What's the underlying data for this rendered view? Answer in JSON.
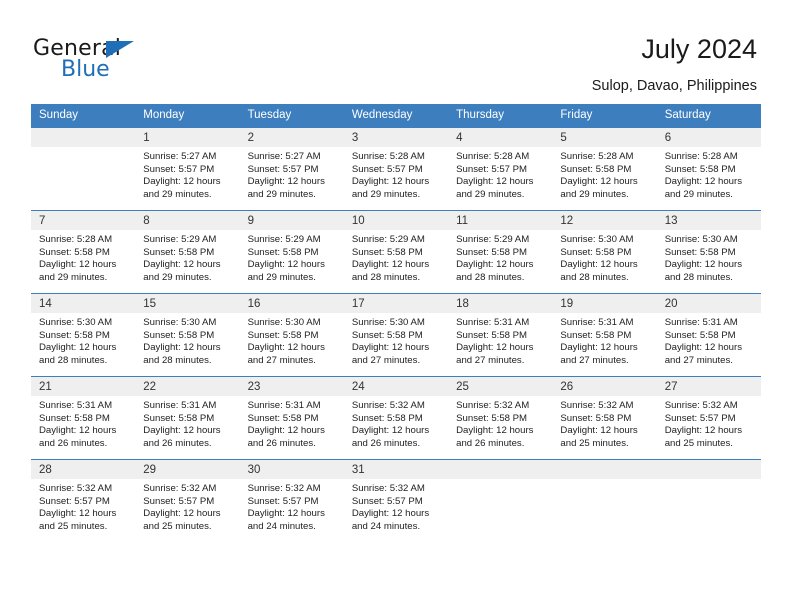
{
  "brand": {
    "name_part1": "General",
    "name_part2": "Blue",
    "triangle_color": "#1f6fb8"
  },
  "header": {
    "title": "July 2024",
    "subtitle": "Sulop, Davao, Philippines"
  },
  "theme": {
    "header_blue": "#3d7ebf",
    "band_gray": "#efefef",
    "text": "#222222"
  },
  "calendar": {
    "weekday_headers": [
      "Sunday",
      "Monday",
      "Tuesday",
      "Wednesday",
      "Thursday",
      "Friday",
      "Saturday"
    ],
    "weeks": [
      [
        {
          "day": "",
          "lines": []
        },
        {
          "day": "1",
          "lines": [
            "Sunrise: 5:27 AM",
            "Sunset: 5:57 PM",
            "Daylight: 12 hours",
            "and 29 minutes."
          ]
        },
        {
          "day": "2",
          "lines": [
            "Sunrise: 5:27 AM",
            "Sunset: 5:57 PM",
            "Daylight: 12 hours",
            "and 29 minutes."
          ]
        },
        {
          "day": "3",
          "lines": [
            "Sunrise: 5:28 AM",
            "Sunset: 5:57 PM",
            "Daylight: 12 hours",
            "and 29 minutes."
          ]
        },
        {
          "day": "4",
          "lines": [
            "Sunrise: 5:28 AM",
            "Sunset: 5:57 PM",
            "Daylight: 12 hours",
            "and 29 minutes."
          ]
        },
        {
          "day": "5",
          "lines": [
            "Sunrise: 5:28 AM",
            "Sunset: 5:58 PM",
            "Daylight: 12 hours",
            "and 29 minutes."
          ]
        },
        {
          "day": "6",
          "lines": [
            "Sunrise: 5:28 AM",
            "Sunset: 5:58 PM",
            "Daylight: 12 hours",
            "and 29 minutes."
          ]
        }
      ],
      [
        {
          "day": "7",
          "lines": [
            "Sunrise: 5:28 AM",
            "Sunset: 5:58 PM",
            "Daylight: 12 hours",
            "and 29 minutes."
          ]
        },
        {
          "day": "8",
          "lines": [
            "Sunrise: 5:29 AM",
            "Sunset: 5:58 PM",
            "Daylight: 12 hours",
            "and 29 minutes."
          ]
        },
        {
          "day": "9",
          "lines": [
            "Sunrise: 5:29 AM",
            "Sunset: 5:58 PM",
            "Daylight: 12 hours",
            "and 29 minutes."
          ]
        },
        {
          "day": "10",
          "lines": [
            "Sunrise: 5:29 AM",
            "Sunset: 5:58 PM",
            "Daylight: 12 hours",
            "and 28 minutes."
          ]
        },
        {
          "day": "11",
          "lines": [
            "Sunrise: 5:29 AM",
            "Sunset: 5:58 PM",
            "Daylight: 12 hours",
            "and 28 minutes."
          ]
        },
        {
          "day": "12",
          "lines": [
            "Sunrise: 5:30 AM",
            "Sunset: 5:58 PM",
            "Daylight: 12 hours",
            "and 28 minutes."
          ]
        },
        {
          "day": "13",
          "lines": [
            "Sunrise: 5:30 AM",
            "Sunset: 5:58 PM",
            "Daylight: 12 hours",
            "and 28 minutes."
          ]
        }
      ],
      [
        {
          "day": "14",
          "lines": [
            "Sunrise: 5:30 AM",
            "Sunset: 5:58 PM",
            "Daylight: 12 hours",
            "and 28 minutes."
          ]
        },
        {
          "day": "15",
          "lines": [
            "Sunrise: 5:30 AM",
            "Sunset: 5:58 PM",
            "Daylight: 12 hours",
            "and 28 minutes."
          ]
        },
        {
          "day": "16",
          "lines": [
            "Sunrise: 5:30 AM",
            "Sunset: 5:58 PM",
            "Daylight: 12 hours",
            "and 27 minutes."
          ]
        },
        {
          "day": "17",
          "lines": [
            "Sunrise: 5:30 AM",
            "Sunset: 5:58 PM",
            "Daylight: 12 hours",
            "and 27 minutes."
          ]
        },
        {
          "day": "18",
          "lines": [
            "Sunrise: 5:31 AM",
            "Sunset: 5:58 PM",
            "Daylight: 12 hours",
            "and 27 minutes."
          ]
        },
        {
          "day": "19",
          "lines": [
            "Sunrise: 5:31 AM",
            "Sunset: 5:58 PM",
            "Daylight: 12 hours",
            "and 27 minutes."
          ]
        },
        {
          "day": "20",
          "lines": [
            "Sunrise: 5:31 AM",
            "Sunset: 5:58 PM",
            "Daylight: 12 hours",
            "and 27 minutes."
          ]
        }
      ],
      [
        {
          "day": "21",
          "lines": [
            "Sunrise: 5:31 AM",
            "Sunset: 5:58 PM",
            "Daylight: 12 hours",
            "and 26 minutes."
          ]
        },
        {
          "day": "22",
          "lines": [
            "Sunrise: 5:31 AM",
            "Sunset: 5:58 PM",
            "Daylight: 12 hours",
            "and 26 minutes."
          ]
        },
        {
          "day": "23",
          "lines": [
            "Sunrise: 5:31 AM",
            "Sunset: 5:58 PM",
            "Daylight: 12 hours",
            "and 26 minutes."
          ]
        },
        {
          "day": "24",
          "lines": [
            "Sunrise: 5:32 AM",
            "Sunset: 5:58 PM",
            "Daylight: 12 hours",
            "and 26 minutes."
          ]
        },
        {
          "day": "25",
          "lines": [
            "Sunrise: 5:32 AM",
            "Sunset: 5:58 PM",
            "Daylight: 12 hours",
            "and 26 minutes."
          ]
        },
        {
          "day": "26",
          "lines": [
            "Sunrise: 5:32 AM",
            "Sunset: 5:58 PM",
            "Daylight: 12 hours",
            "and 25 minutes."
          ]
        },
        {
          "day": "27",
          "lines": [
            "Sunrise: 5:32 AM",
            "Sunset: 5:57 PM",
            "Daylight: 12 hours",
            "and 25 minutes."
          ]
        }
      ],
      [
        {
          "day": "28",
          "lines": [
            "Sunrise: 5:32 AM",
            "Sunset: 5:57 PM",
            "Daylight: 12 hours",
            "and 25 minutes."
          ]
        },
        {
          "day": "29",
          "lines": [
            "Sunrise: 5:32 AM",
            "Sunset: 5:57 PM",
            "Daylight: 12 hours",
            "and 25 minutes."
          ]
        },
        {
          "day": "30",
          "lines": [
            "Sunrise: 5:32 AM",
            "Sunset: 5:57 PM",
            "Daylight: 12 hours",
            "and 24 minutes."
          ]
        },
        {
          "day": "31",
          "lines": [
            "Sunrise: 5:32 AM",
            "Sunset: 5:57 PM",
            "Daylight: 12 hours",
            "and 24 minutes."
          ]
        },
        {
          "day": "",
          "lines": []
        },
        {
          "day": "",
          "lines": []
        },
        {
          "day": "",
          "lines": []
        }
      ]
    ]
  }
}
